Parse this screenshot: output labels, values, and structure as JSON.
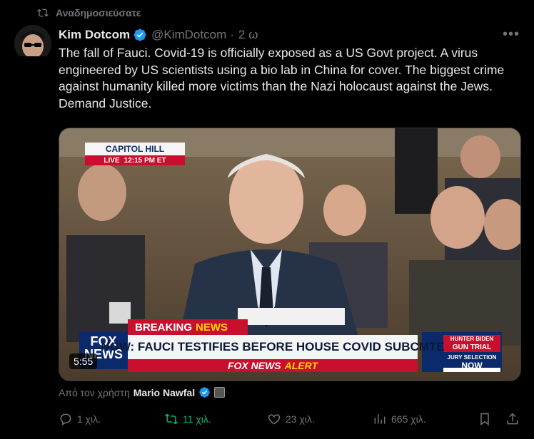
{
  "repost": {
    "label": "Αναδημοσιεύσατε",
    "icon": "repost-icon"
  },
  "author": {
    "name": "Kim Dotcom",
    "handle": "@KimDotcom",
    "separator": "·",
    "time": "2 ω"
  },
  "tweet_text": "The fall of Fauci. Covid-19 is officially exposed as a US Govt project. A virus engineered by US scientists using a bio lab in China for cover. The biggest crime against humanity killed more victims than the Nazi holocaust against the Jews. Demand Justice.",
  "video": {
    "duration": "5:55",
    "overlay": {
      "location": "CAPITOL HILL",
      "live": "LIVE",
      "live_time": "12:15 PM ET",
      "breaking_a": "BREAKING",
      "breaking_b": "NEWS",
      "headline": "NOW: FAUCI TESTIFIES BEFORE HOUSE COVID SUBCMTE",
      "network_a": "FOX",
      "network_b": "NEWS",
      "alert_a": "FOX NEWS",
      "alert_b": "ALERT",
      "side_title_1": "HUNTER BIDEN",
      "side_title_2": "GUN TRIAL",
      "side_sub": "JURY SELECTION",
      "side_now": "NOW"
    }
  },
  "attribution": {
    "prefix": "Από τον χρήστη",
    "author": "Mario Nawfal"
  },
  "actions": {
    "replies": "1 χιλ.",
    "reposts": "11 χιλ.",
    "likes": "23 χιλ.",
    "views": "665 χιλ."
  },
  "colors": {
    "verified": "#1d9bf0",
    "repost_active": "#00ba7c",
    "muted": "#71767b",
    "fox_red": "#c8102e",
    "fox_blue": "#0a2a6b"
  }
}
